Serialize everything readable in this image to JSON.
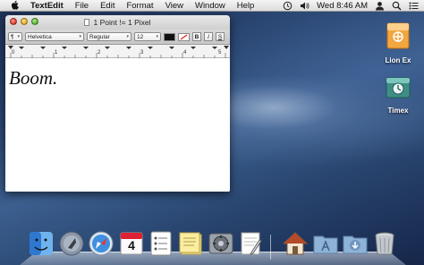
{
  "menubar": {
    "app_name": "TextEdit",
    "menus": [
      "File",
      "Edit",
      "Format",
      "View",
      "Window",
      "Help"
    ],
    "clock": "Wed 8:46 AM"
  },
  "window": {
    "title": "1 Point != 1 Pixel",
    "toolbar": {
      "paragraph": "¶",
      "font_family": "Helvetica",
      "font_style": "Regular",
      "font_size": "12",
      "bold": "B",
      "italic": "I",
      "underline": "S"
    },
    "ruler_numbers": [
      "0",
      "1",
      "2",
      "3",
      "4",
      "5"
    ],
    "document_text": "Boom."
  },
  "desktop": {
    "icons": [
      {
        "label": "Lion Ex",
        "icon": "usb-drive-icon"
      },
      {
        "label": "Timex",
        "icon": "time-machine-drive-icon"
      }
    ]
  },
  "dock": {
    "items": [
      "finder-icon",
      "launchpad-icon",
      "safari-icon",
      "calendar-icon",
      "reminders-icon",
      "stickies-icon",
      "system-preferences-icon",
      "textedit-icon",
      "home-folder-icon",
      "applications-folder-icon",
      "downloads-folder-icon",
      "trash-icon"
    ],
    "calendar_day": "4"
  }
}
